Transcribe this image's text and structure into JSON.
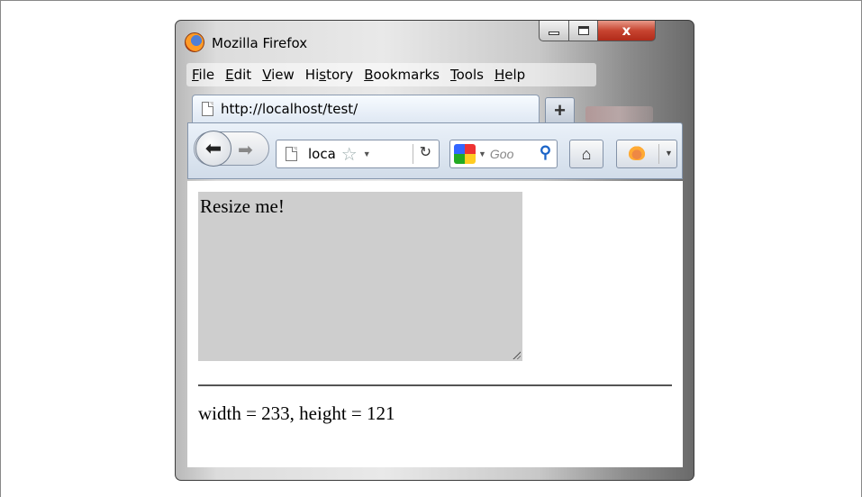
{
  "window": {
    "title": "Mozilla Firefox",
    "controls": {
      "minimize": "minimize",
      "maximize": "maximize",
      "close": "x"
    }
  },
  "menubar": {
    "items": [
      {
        "label": "File",
        "accel": "F"
      },
      {
        "label": "Edit",
        "accel": "E"
      },
      {
        "label": "View",
        "accel": "V"
      },
      {
        "label": "History",
        "accel": "s"
      },
      {
        "label": "Bookmarks",
        "accel": "B"
      },
      {
        "label": "Tools",
        "accel": "T"
      },
      {
        "label": "Help",
        "accel": "H"
      }
    ]
  },
  "tabs": {
    "active": {
      "title": "http://localhost/test/"
    },
    "new_tab_label": "+"
  },
  "navbar": {
    "url": "loca",
    "search_placeholder": "Goo",
    "icons": {
      "back": "back-arrow-icon",
      "forward": "forward-arrow-icon",
      "bookmark": "star-icon",
      "reload": "reload-icon",
      "search_engine": "google-icon",
      "search": "magnifier-icon",
      "home": "home-icon",
      "addon": "ladybug-icon"
    }
  },
  "page": {
    "resize_box_text": "Resize me!",
    "dimensions_text": "width = 233, height = 121"
  },
  "colors": {
    "resize_box": "#cecece",
    "close_button": "#c74430",
    "navbar": "#dde6f1"
  }
}
